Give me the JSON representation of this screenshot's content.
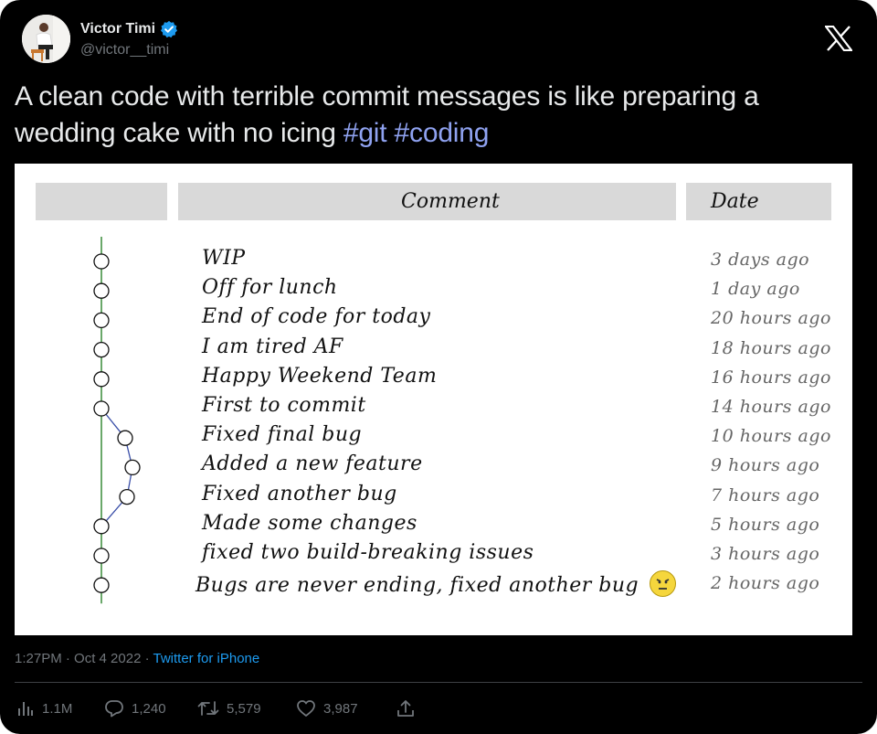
{
  "author": {
    "name": "Victor Timi",
    "handle": "@victor__timi",
    "verified": true,
    "avatar_icon": "profile-photo"
  },
  "platform_logo": "x-logo-icon",
  "tweet": {
    "text": "A clean code with terrible commit messages is like preparing a wedding cake with no icing ",
    "hashtags": [
      "#git",
      "#coding"
    ]
  },
  "media": {
    "headers": {
      "graph": "",
      "comment": "Comment",
      "date": "Date"
    },
    "commits": [
      {
        "message": "WIP",
        "date": "3 days ago",
        "branch": "main"
      },
      {
        "message": "Off for lunch",
        "date": "1 day ago",
        "branch": "main"
      },
      {
        "message": "End of code for today",
        "date": "20 hours ago",
        "branch": "main"
      },
      {
        "message": "I am tired AF",
        "date": "18 hours ago",
        "branch": "main"
      },
      {
        "message": "Happy Weekend Team",
        "date": "16 hours ago",
        "branch": "main"
      },
      {
        "message": "First to commit",
        "date": "14 hours ago",
        "branch": "main"
      },
      {
        "message": "Fixed final bug",
        "date": "10 hours ago",
        "branch": "feature"
      },
      {
        "message": "Added a new feature",
        "date": "9 hours ago",
        "branch": "feature"
      },
      {
        "message": "Fixed another bug",
        "date": "7 hours ago",
        "branch": "feature"
      },
      {
        "message": "Made some changes",
        "date": "5 hours ago",
        "branch": "main"
      },
      {
        "message": "fixed two build-breaking issues",
        "date": "3 hours ago",
        "branch": "main"
      },
      {
        "message": "Bugs are never ending, fixed another bug",
        "date": "2 hours ago",
        "branch": "main",
        "emoji": "angry-face"
      }
    ],
    "colors": {
      "main_line": "#1a7a1a",
      "branch_line": "#3a4fa8",
      "header_bg": "#d9d9d9"
    }
  },
  "meta": {
    "time": "1:27PM",
    "separator": " · ",
    "date": "Oct 4 2022",
    "source": "Twitter for iPhone"
  },
  "stats": {
    "views": "1.1M",
    "replies": "1,240",
    "retweets": "5,579",
    "likes": "3,987"
  },
  "colors": {
    "background": "#000000",
    "text": "#e7e9ea",
    "muted": "#71767b",
    "link": "#1d9bf0",
    "hashtag": "#8fa2f0",
    "verified": "#1d9bf0"
  }
}
